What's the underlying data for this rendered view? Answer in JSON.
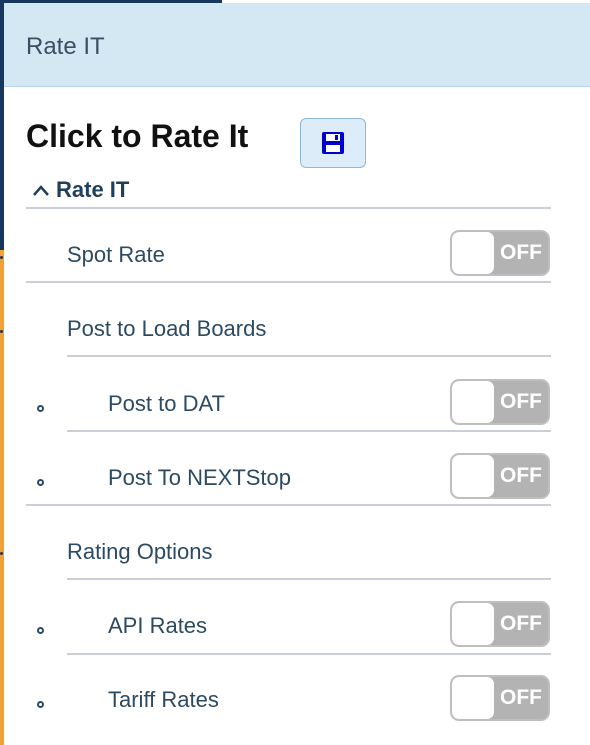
{
  "header": {
    "title": "Rate IT"
  },
  "page": {
    "title": "Click to Rate It",
    "save_icon": "save-icon",
    "accent_color": "#0000cc"
  },
  "section": {
    "label": "Rate IT",
    "icon": "chevron-up-icon"
  },
  "rows": {
    "spot_rate": {
      "label": "Spot Rate",
      "toggle": "OFF"
    },
    "post_to_load_boards": {
      "label": "Post to Load Boards"
    },
    "post_to_dat": {
      "label": "Post to DAT",
      "toggle": "OFF"
    },
    "post_to_nextstop": {
      "label": "Post To NEXTStop",
      "toggle": "OFF"
    },
    "rating_options": {
      "label": "Rating Options"
    },
    "api_rates": {
      "label": "API Rates",
      "toggle": "OFF"
    },
    "tariff_rates": {
      "label": "Tariff Rates",
      "toggle": "OFF"
    }
  }
}
